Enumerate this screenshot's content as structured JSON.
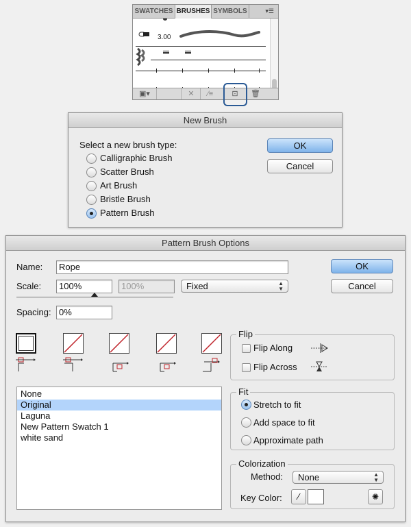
{
  "brushes_panel": {
    "tabs": [
      "SWATCHES",
      "BRUSHES",
      "SYMBOLS"
    ],
    "active_tab": "BRUSHES",
    "brush_size": "3.00"
  },
  "new_brush": {
    "title": "New Brush",
    "prompt": "Select a new brush type:",
    "options": [
      "Calligraphic Brush",
      "Scatter Brush",
      "Art Brush",
      "Bristle Brush",
      "Pattern Brush"
    ],
    "selected": "Pattern Brush",
    "ok_label": "OK",
    "cancel_label": "Cancel"
  },
  "pattern_options": {
    "title": "Pattern Brush Options",
    "name_label": "Name:",
    "name_value": "Rope",
    "scale_label": "Scale:",
    "scale_value": "100%",
    "scale_max_value": "100%",
    "scale_mode": "Fixed",
    "spacing_label": "Spacing:",
    "spacing_value": "0%",
    "ok_label": "OK",
    "cancel_label": "Cancel",
    "swatch_list": [
      "None",
      "Original",
      "Laguna",
      "New Pattern Swatch 1",
      "white sand"
    ],
    "selected_swatch": "Original",
    "flip": {
      "title": "Flip",
      "along_label": "Flip Along",
      "across_label": "Flip Across"
    },
    "fit": {
      "title": "Fit",
      "options": [
        "Stretch to fit",
        "Add space to fit",
        "Approximate path"
      ],
      "selected": "Stretch to fit"
    },
    "colorization": {
      "title": "Colorization",
      "method_label": "Method:",
      "method_value": "None",
      "key_color_label": "Key Color:"
    }
  },
  "colors": {
    "accent_blue": "#2a5a95",
    "selection_blue": "#b3d4fb",
    "tile_slash_red": "#c0262d"
  }
}
